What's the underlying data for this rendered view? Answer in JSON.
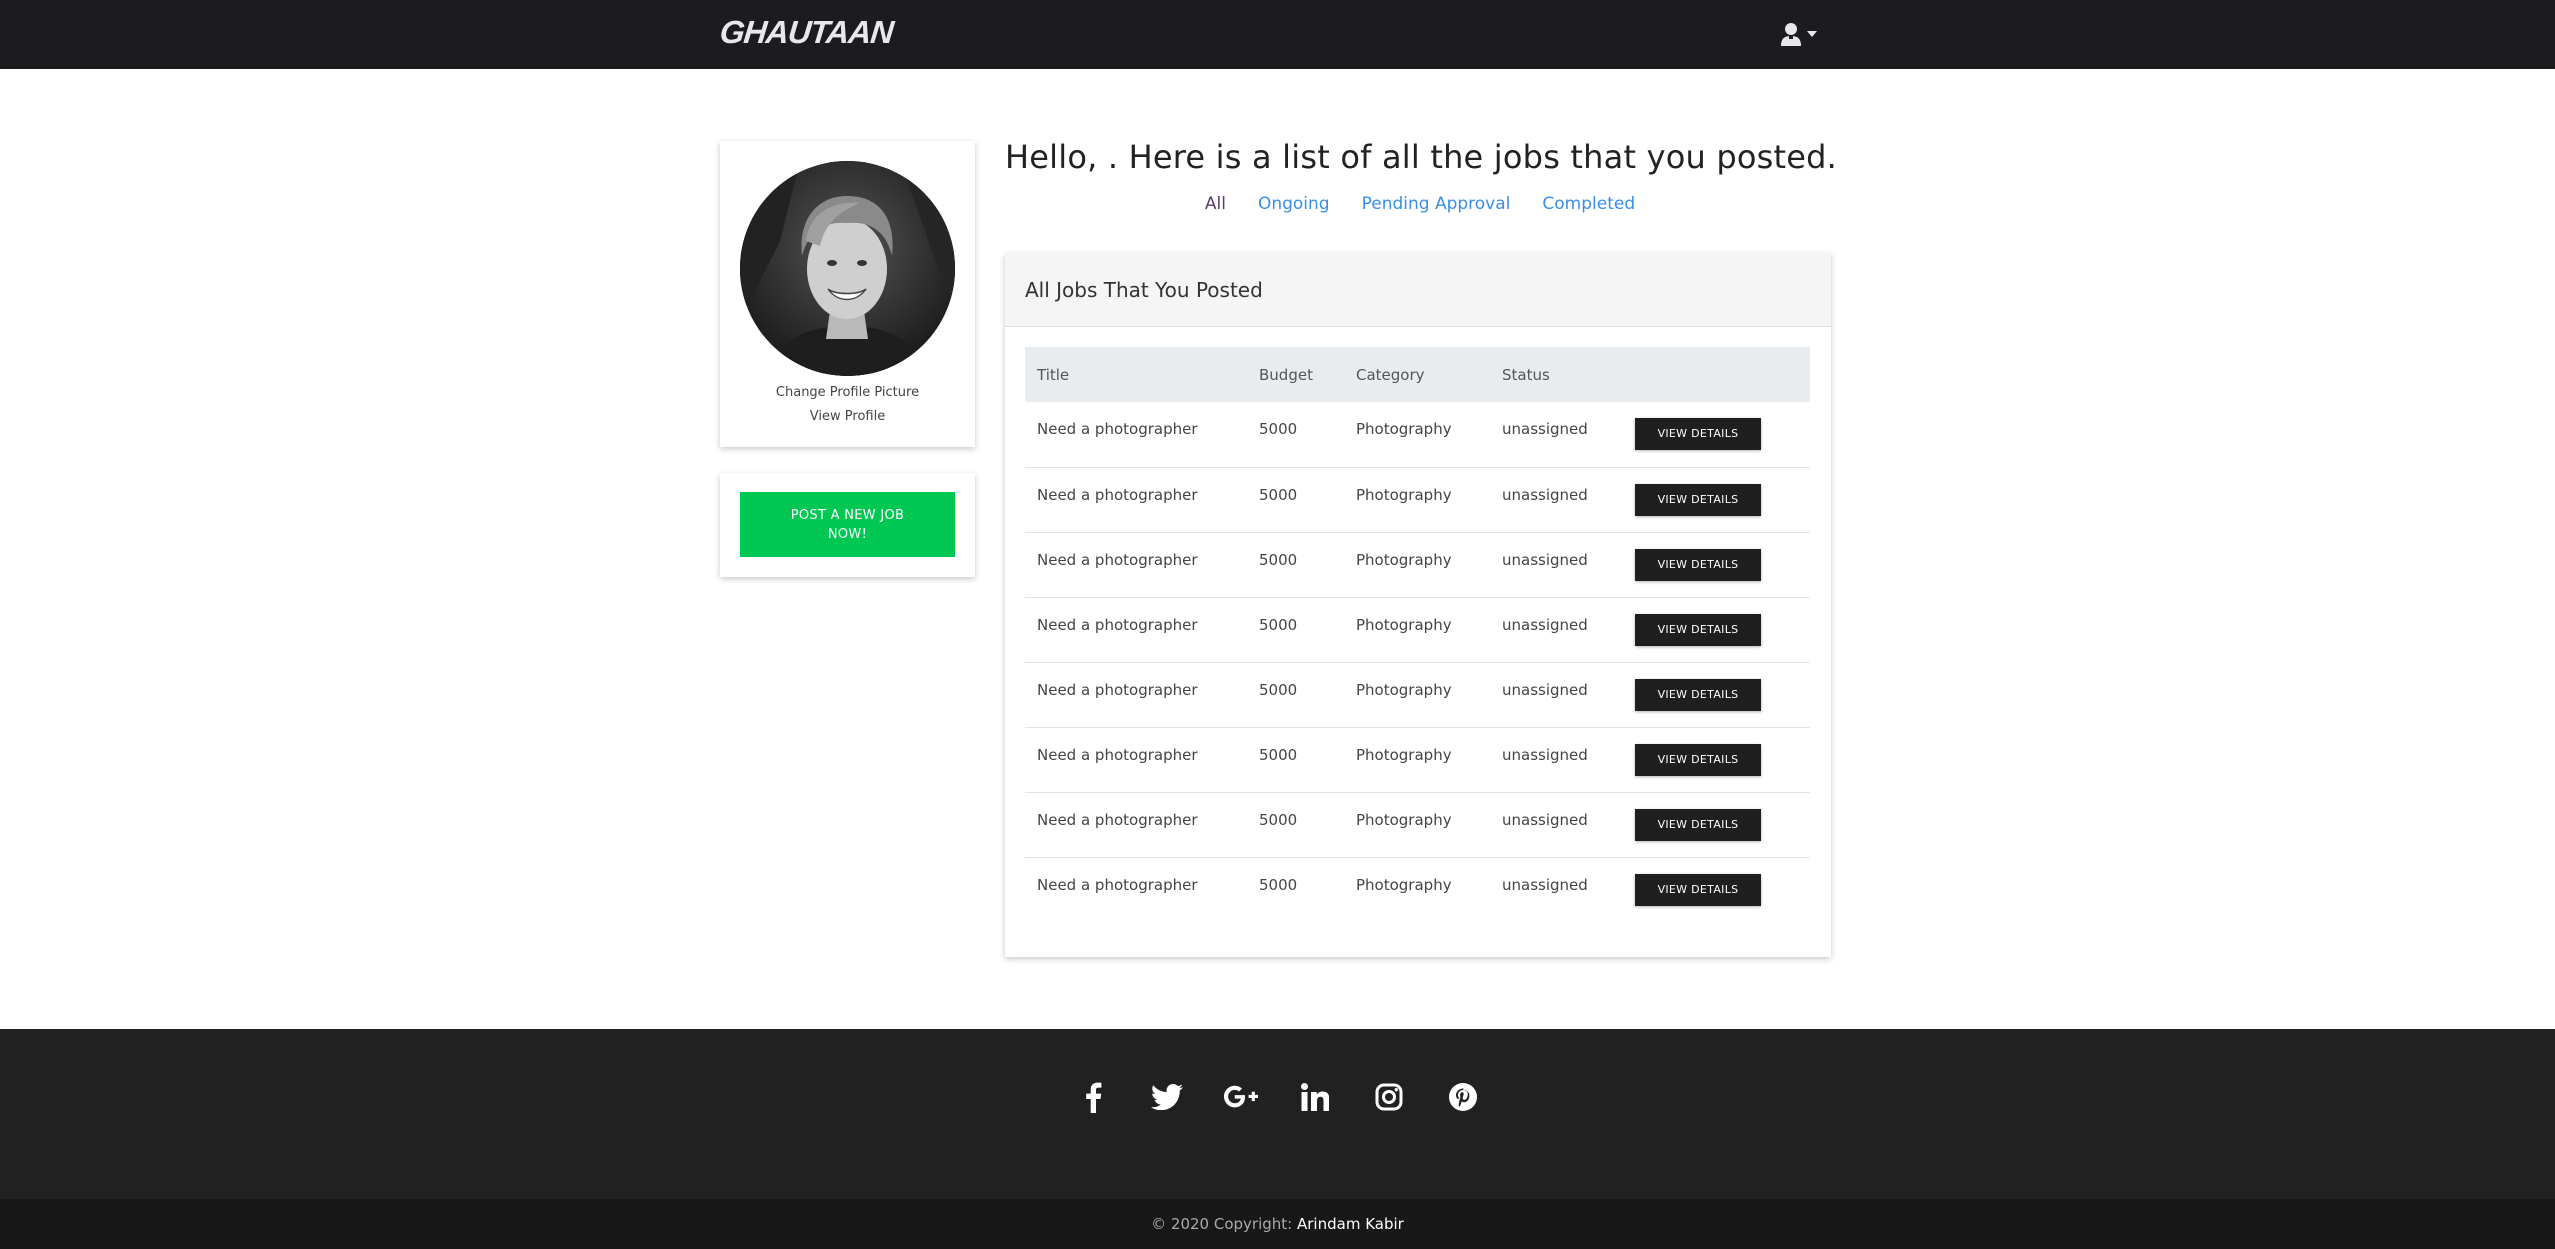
{
  "navbar": {
    "brand": "GHAUTAAN",
    "user_icon": "user-icon",
    "caret_icon": "caret-down-icon"
  },
  "sidebar": {
    "change_picture": "Change Profile Picture",
    "view_profile": "View Profile",
    "post_job": "POST A NEW JOB NOW!"
  },
  "main": {
    "greeting": "Hello, . Here is a list of all the jobs that you posted.",
    "tabs": [
      {
        "label": "All",
        "active": true
      },
      {
        "label": "Ongoing",
        "active": false
      },
      {
        "label": "Pending Approval",
        "active": false
      },
      {
        "label": "Completed",
        "active": false
      }
    ],
    "card_title": "All Jobs That You Posted",
    "columns": [
      "Title",
      "Budget",
      "Category",
      "Status"
    ],
    "rows": [
      {
        "title": "Need a photographer",
        "budget": "5000",
        "category": "Photography",
        "status": "unassigned",
        "action": "VIEW DETAILS"
      },
      {
        "title": "Need a photographer",
        "budget": "5000",
        "category": "Photography",
        "status": "unassigned",
        "action": "VIEW DETAILS"
      },
      {
        "title": "Need a photographer",
        "budget": "5000",
        "category": "Photography",
        "status": "unassigned",
        "action": "VIEW DETAILS"
      },
      {
        "title": "Need a photographer",
        "budget": "5000",
        "category": "Photography",
        "status": "unassigned",
        "action": "VIEW DETAILS"
      },
      {
        "title": "Need a photographer",
        "budget": "5000",
        "category": "Photography",
        "status": "unassigned",
        "action": "VIEW DETAILS"
      },
      {
        "title": "Need a photographer",
        "budget": "5000",
        "category": "Photography",
        "status": "unassigned",
        "action": "VIEW DETAILS"
      },
      {
        "title": "Need a photographer",
        "budget": "5000",
        "category": "Photography",
        "status": "unassigned",
        "action": "VIEW DETAILS"
      },
      {
        "title": "Need a photographer",
        "budget": "5000",
        "category": "Photography",
        "status": "unassigned",
        "action": "VIEW DETAILS"
      }
    ]
  },
  "footer": {
    "social_icons": [
      "facebook-icon",
      "twitter-icon",
      "google-plus-icon",
      "linkedin-icon",
      "instagram-icon",
      "pinterest-icon"
    ],
    "copyright_prefix": "© 2020 Copyright:",
    "copyright_owner": "Arindam Kabir"
  },
  "colors": {
    "navbar": "#1c1c1e",
    "post_button": "#00c853",
    "link": "#3a8ee6",
    "active_tab": "#5b3a6e",
    "footer": "#212121",
    "copyright_bar": "#181818"
  }
}
